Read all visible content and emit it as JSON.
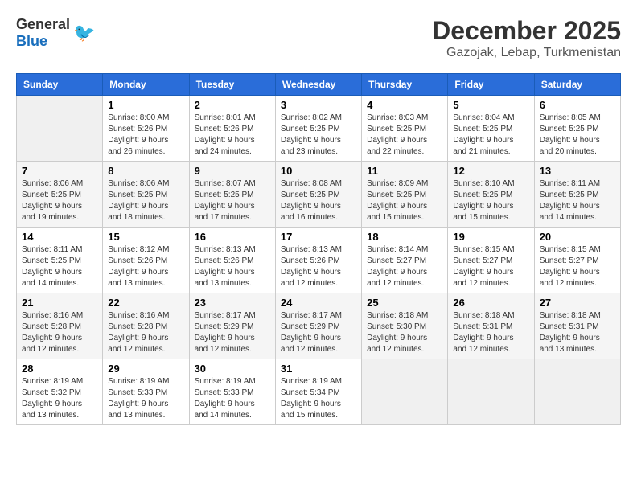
{
  "logo": {
    "general": "General",
    "blue": "Blue"
  },
  "header": {
    "month": "December 2025",
    "location": "Gazojak, Lebap, Turkmenistan"
  },
  "days_of_week": [
    "Sunday",
    "Monday",
    "Tuesday",
    "Wednesday",
    "Thursday",
    "Friday",
    "Saturday"
  ],
  "weeks": [
    [
      {
        "day": "",
        "empty": true
      },
      {
        "day": "1",
        "sunrise": "Sunrise: 8:00 AM",
        "sunset": "Sunset: 5:26 PM",
        "daylight": "Daylight: 9 hours and 26 minutes."
      },
      {
        "day": "2",
        "sunrise": "Sunrise: 8:01 AM",
        "sunset": "Sunset: 5:26 PM",
        "daylight": "Daylight: 9 hours and 24 minutes."
      },
      {
        "day": "3",
        "sunrise": "Sunrise: 8:02 AM",
        "sunset": "Sunset: 5:25 PM",
        "daylight": "Daylight: 9 hours and 23 minutes."
      },
      {
        "day": "4",
        "sunrise": "Sunrise: 8:03 AM",
        "sunset": "Sunset: 5:25 PM",
        "daylight": "Daylight: 9 hours and 22 minutes."
      },
      {
        "day": "5",
        "sunrise": "Sunrise: 8:04 AM",
        "sunset": "Sunset: 5:25 PM",
        "daylight": "Daylight: 9 hours and 21 minutes."
      },
      {
        "day": "6",
        "sunrise": "Sunrise: 8:05 AM",
        "sunset": "Sunset: 5:25 PM",
        "daylight": "Daylight: 9 hours and 20 minutes."
      }
    ],
    [
      {
        "day": "7",
        "sunrise": "Sunrise: 8:06 AM",
        "sunset": "Sunset: 5:25 PM",
        "daylight": "Daylight: 9 hours and 19 minutes."
      },
      {
        "day": "8",
        "sunrise": "Sunrise: 8:06 AM",
        "sunset": "Sunset: 5:25 PM",
        "daylight": "Daylight: 9 hours and 18 minutes."
      },
      {
        "day": "9",
        "sunrise": "Sunrise: 8:07 AM",
        "sunset": "Sunset: 5:25 PM",
        "daylight": "Daylight: 9 hours and 17 minutes."
      },
      {
        "day": "10",
        "sunrise": "Sunrise: 8:08 AM",
        "sunset": "Sunset: 5:25 PM",
        "daylight": "Daylight: 9 hours and 16 minutes."
      },
      {
        "day": "11",
        "sunrise": "Sunrise: 8:09 AM",
        "sunset": "Sunset: 5:25 PM",
        "daylight": "Daylight: 9 hours and 15 minutes."
      },
      {
        "day": "12",
        "sunrise": "Sunrise: 8:10 AM",
        "sunset": "Sunset: 5:25 PM",
        "daylight": "Daylight: 9 hours and 15 minutes."
      },
      {
        "day": "13",
        "sunrise": "Sunrise: 8:11 AM",
        "sunset": "Sunset: 5:25 PM",
        "daylight": "Daylight: 9 hours and 14 minutes."
      }
    ],
    [
      {
        "day": "14",
        "sunrise": "Sunrise: 8:11 AM",
        "sunset": "Sunset: 5:25 PM",
        "daylight": "Daylight: 9 hours and 14 minutes."
      },
      {
        "day": "15",
        "sunrise": "Sunrise: 8:12 AM",
        "sunset": "Sunset: 5:26 PM",
        "daylight": "Daylight: 9 hours and 13 minutes."
      },
      {
        "day": "16",
        "sunrise": "Sunrise: 8:13 AM",
        "sunset": "Sunset: 5:26 PM",
        "daylight": "Daylight: 9 hours and 13 minutes."
      },
      {
        "day": "17",
        "sunrise": "Sunrise: 8:13 AM",
        "sunset": "Sunset: 5:26 PM",
        "daylight": "Daylight: 9 hours and 12 minutes."
      },
      {
        "day": "18",
        "sunrise": "Sunrise: 8:14 AM",
        "sunset": "Sunset: 5:27 PM",
        "daylight": "Daylight: 9 hours and 12 minutes."
      },
      {
        "day": "19",
        "sunrise": "Sunrise: 8:15 AM",
        "sunset": "Sunset: 5:27 PM",
        "daylight": "Daylight: 9 hours and 12 minutes."
      },
      {
        "day": "20",
        "sunrise": "Sunrise: 8:15 AM",
        "sunset": "Sunset: 5:27 PM",
        "daylight": "Daylight: 9 hours and 12 minutes."
      }
    ],
    [
      {
        "day": "21",
        "sunrise": "Sunrise: 8:16 AM",
        "sunset": "Sunset: 5:28 PM",
        "daylight": "Daylight: 9 hours and 12 minutes."
      },
      {
        "day": "22",
        "sunrise": "Sunrise: 8:16 AM",
        "sunset": "Sunset: 5:28 PM",
        "daylight": "Daylight: 9 hours and 12 minutes."
      },
      {
        "day": "23",
        "sunrise": "Sunrise: 8:17 AM",
        "sunset": "Sunset: 5:29 PM",
        "daylight": "Daylight: 9 hours and 12 minutes."
      },
      {
        "day": "24",
        "sunrise": "Sunrise: 8:17 AM",
        "sunset": "Sunset: 5:29 PM",
        "daylight": "Daylight: 9 hours and 12 minutes."
      },
      {
        "day": "25",
        "sunrise": "Sunrise: 8:18 AM",
        "sunset": "Sunset: 5:30 PM",
        "daylight": "Daylight: 9 hours and 12 minutes."
      },
      {
        "day": "26",
        "sunrise": "Sunrise: 8:18 AM",
        "sunset": "Sunset: 5:31 PM",
        "daylight": "Daylight: 9 hours and 12 minutes."
      },
      {
        "day": "27",
        "sunrise": "Sunrise: 8:18 AM",
        "sunset": "Sunset: 5:31 PM",
        "daylight": "Daylight: 9 hours and 13 minutes."
      }
    ],
    [
      {
        "day": "28",
        "sunrise": "Sunrise: 8:19 AM",
        "sunset": "Sunset: 5:32 PM",
        "daylight": "Daylight: 9 hours and 13 minutes."
      },
      {
        "day": "29",
        "sunrise": "Sunrise: 8:19 AM",
        "sunset": "Sunset: 5:33 PM",
        "daylight": "Daylight: 9 hours and 13 minutes."
      },
      {
        "day": "30",
        "sunrise": "Sunrise: 8:19 AM",
        "sunset": "Sunset: 5:33 PM",
        "daylight": "Daylight: 9 hours and 14 minutes."
      },
      {
        "day": "31",
        "sunrise": "Sunrise: 8:19 AM",
        "sunset": "Sunset: 5:34 PM",
        "daylight": "Daylight: 9 hours and 15 minutes."
      },
      {
        "day": "",
        "empty": true
      },
      {
        "day": "",
        "empty": true
      },
      {
        "day": "",
        "empty": true
      }
    ]
  ]
}
